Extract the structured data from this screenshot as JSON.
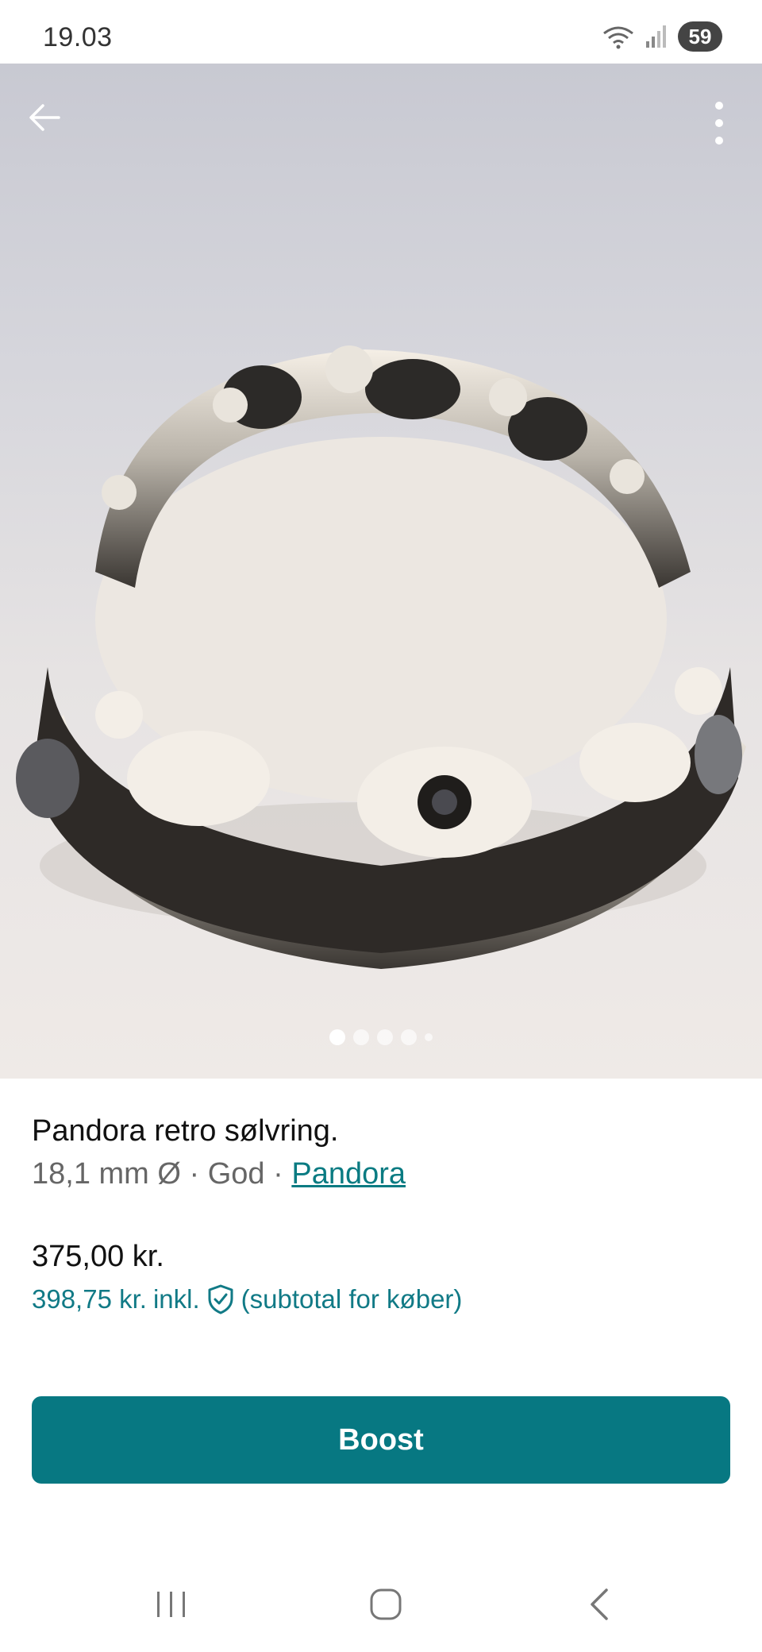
{
  "status_bar": {
    "time": "19.03",
    "battery": "59",
    "icons": [
      "wifi-icon",
      "signal-icon"
    ]
  },
  "hero": {
    "image_alt": "Pandora retro sølvring",
    "page_count": 5,
    "active_page": 1,
    "icons": [
      "back-arrow-icon",
      "more-vertical-icon"
    ]
  },
  "listing": {
    "title": "Pandora retro sølvring.",
    "size": "18,1 mm Ø",
    "separator": "·",
    "condition": "God",
    "brand": "Pandora",
    "price": "375,00 kr.",
    "price_incl_amount": "398,75 kr.",
    "price_incl_label": "inkl.",
    "price_incl_note": "(subtotal for køber)"
  },
  "actions": {
    "boost_label": "Boost"
  },
  "nav": {
    "icons": [
      "recents-icon",
      "home-icon",
      "back-icon"
    ]
  },
  "colors": {
    "accent": "#077882",
    "link": "#0a7b82"
  }
}
